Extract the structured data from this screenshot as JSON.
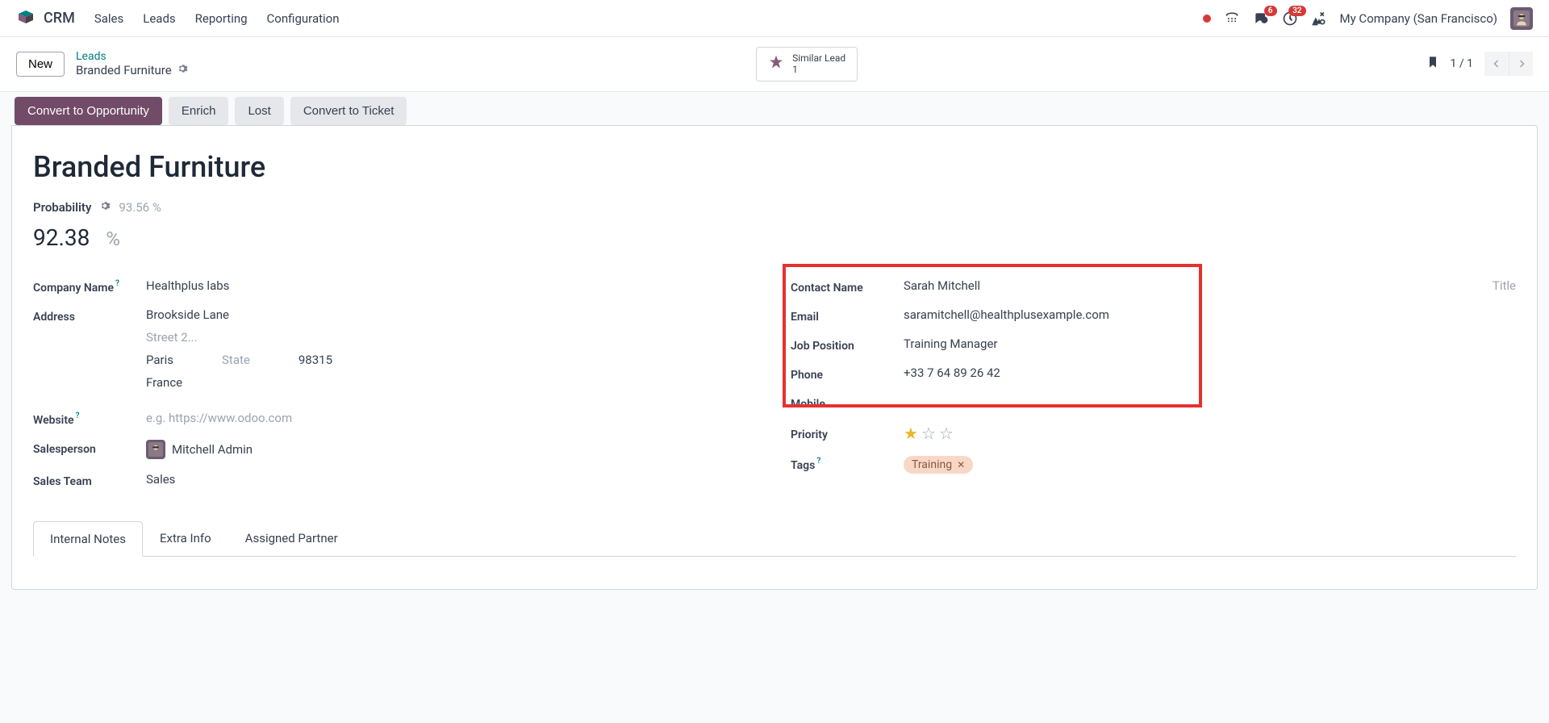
{
  "nav": {
    "app": "CRM",
    "menu": [
      "Sales",
      "Leads",
      "Reporting",
      "Configuration"
    ],
    "msg_badge": "6",
    "act_badge": "32",
    "company": "My Company (San Francisco)"
  },
  "breadcrumb": {
    "new_btn": "New",
    "back": "Leads",
    "current": "Branded Furniture",
    "similar_label": "Similar Lead",
    "similar_count": "1",
    "page": "1 / 1"
  },
  "actions": {
    "convert": "Convert to Opportunity",
    "enrich": "Enrich",
    "lost": "Lost",
    "ticket": "Convert to Ticket"
  },
  "record": {
    "title": "Branded Furniture",
    "probability_label": "Probability",
    "probability_hint": "93.56 %",
    "probability_value": "92.38",
    "probability_unit": "%"
  },
  "left": {
    "company_label": "Company Name",
    "company": "Healthplus labs",
    "address_label": "Address",
    "street1": "Brookside Lane",
    "street2_placeholder": "Street 2...",
    "city": "Paris",
    "state_placeholder": "State",
    "zip": "98315",
    "country": "France",
    "website_label": "Website",
    "website_placeholder": "e.g. https://www.odoo.com",
    "salesperson_label": "Salesperson",
    "salesperson": "Mitchell Admin",
    "team_label": "Sales Team",
    "team": "Sales"
  },
  "right": {
    "contact_label": "Contact Name",
    "contact": "Sarah Mitchell",
    "title_placeholder": "Title",
    "email_label": "Email",
    "email": "saramitchell@healthplusexample.com",
    "job_label": "Job Position",
    "job": "Training Manager",
    "phone_label": "Phone",
    "phone": "+33 7 64 89 26 42",
    "mobile_label": "Mobile",
    "priority_label": "Priority",
    "tags_label": "Tags",
    "tag1": "Training"
  },
  "tabs": {
    "t1": "Internal Notes",
    "t2": "Extra Info",
    "t3": "Assigned Partner"
  }
}
